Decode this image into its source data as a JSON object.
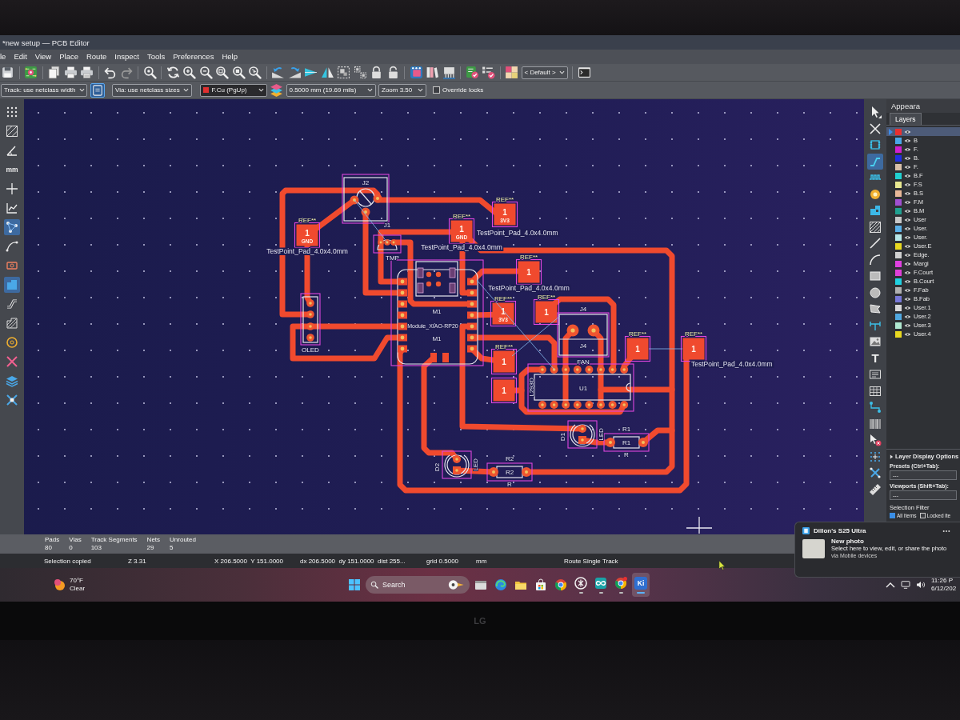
{
  "window": {
    "title": "*new setup — PCB Editor"
  },
  "menu": [
    "le",
    "Edit",
    "View",
    "Place",
    "Route",
    "Inspect",
    "Tools",
    "Preferences",
    "Help"
  ],
  "toolbar": {
    "preset": "< Default >"
  },
  "options_bar": {
    "track_width": "Track: use netclass width",
    "auto_width": {
      "on": true
    },
    "via_size": "Via: use netclass sizes",
    "layer": "F.Cu (PgUp)",
    "grid": "0.5000 mm (19.69 mils)",
    "zoom": "Zoom 3.50",
    "override_locks": {
      "label": "Override locks",
      "checked": false
    }
  },
  "left_toolbar": [
    {
      "on": false
    },
    {
      "on": false
    },
    {
      "on": false
    },
    {
      "label": "mm",
      "on": false
    },
    {
      "on": false
    },
    {
      "on": false
    },
    {
      "on": true
    },
    {
      "on": false
    },
    {
      "on": false
    },
    {
      "on": true
    },
    {
      "on": false
    },
    {
      "on": false
    },
    {
      "on": false
    },
    {
      "on": false
    },
    {
      "on": false
    },
    {
      "on": false
    }
  ],
  "board": {
    "footprints": [
      {
        "kind": "test_point",
        "ref": "REF**",
        "pad": "1",
        "net": "GND",
        "value": "TestPoint_Pad_4.0x4.0mm"
      },
      {
        "kind": "connector",
        "ref": "J2"
      },
      {
        "kind": "sensor",
        "ref": "J1",
        "value": "TMP"
      },
      {
        "kind": "test_point",
        "ref": "REF**",
        "pad": "1",
        "net": "GND",
        "value": "TestPoint_Pad_4.0x4.0mm"
      },
      {
        "kind": "test_point",
        "ref": "REF**",
        "pad": "1",
        "net": "3V3",
        "value": "TestPoint_Pad_4.0x4.0mm"
      },
      {
        "kind": "header",
        "value": "OLED"
      },
      {
        "kind": "module",
        "ref": "M1",
        "value": "Module_XIAO-RP20",
        "fab_ref": "M1"
      },
      {
        "kind": "test_point",
        "ref": "REF**",
        "pad": "1",
        "value": "TestPoint_Pad_4.0x4.0mm"
      },
      {
        "kind": "test_point",
        "ref": "REF**",
        "pad": "1",
        "net": "3V3"
      },
      {
        "kind": "test_point",
        "ref": "REF**",
        "pad": "1"
      },
      {
        "kind": "test_point",
        "ref": "REF**",
        "pad": "1"
      },
      {
        "kind": "fan_connector",
        "ref": "J4",
        "fab_ref": "J4",
        "value": "FAN"
      },
      {
        "kind": "test_point",
        "ref": "REF**",
        "pad": "1"
      },
      {
        "kind": "test_point",
        "ref": "REF**",
        "pad": "1",
        "value": "TestPoint_Pad_4.0x4.0mm"
      },
      {
        "kind": "test_point",
        "pad": "1"
      },
      {
        "kind": "ic",
        "ref": "U1",
        "value": "L293D"
      },
      {
        "kind": "led",
        "ref": "D2",
        "value": "LED"
      },
      {
        "kind": "resistor",
        "ref": "R2",
        "fab_ref": "R2",
        "value": "R"
      },
      {
        "kind": "led",
        "ref": "D1",
        "value": "LED"
      },
      {
        "kind": "resistor",
        "ref": "R1",
        "fab_ref": "R1",
        "value": "R"
      }
    ]
  },
  "draw_toolbar": [
    {
      "selected": false
    },
    {
      "selected": false
    },
    {
      "selected": false
    },
    {
      "selected": true
    },
    {
      "selected": false
    },
    {
      "selected": false
    },
    {
      "selected": false
    },
    {
      "selected": false
    },
    {
      "selected": false
    },
    {
      "selected": false
    },
    {
      "selected": false
    },
    {
      "selected": false
    },
    {
      "selected": false
    },
    {
      "selected": false
    },
    {
      "selected": false
    },
    {
      "label": "T",
      "selected": false
    },
    {
      "selected": false
    },
    {
      "selected": false
    },
    {
      "selected": false
    },
    {
      "selected": false
    },
    {
      "selected": false
    },
    {
      "selected": false
    },
    {
      "selected": false
    },
    {
      "selected": false
    }
  ],
  "appearance": {
    "title": "Appeara",
    "tabs": [
      {
        "label": "Layers",
        "selected": true
      }
    ],
    "layers": [
      {
        "color": "#e83030",
        "visible": true,
        "selected": true
      },
      {
        "name": "B",
        "color": "#4aa8e8",
        "visible": true,
        "selected": false
      },
      {
        "name": "F.",
        "color": "#d020d0",
        "visible": true,
        "selected": false
      },
      {
        "name": "B.",
        "color": "#2030e0",
        "visible": true,
        "selected": false
      },
      {
        "name": "F.",
        "color": "#d8c0a8",
        "visible": true,
        "selected": false
      },
      {
        "name": "B.F",
        "color": "#20d0d0",
        "visible": true,
        "selected": false
      },
      {
        "name": "F.S",
        "color": "#e8e890",
        "visible": true,
        "selected": false
      },
      {
        "name": "B.S",
        "color": "#e8b898",
        "visible": true,
        "selected": false
      },
      {
        "name": "F.M",
        "color": "#a050d0",
        "visible": true,
        "selected": false
      },
      {
        "name": "B.M",
        "color": "#20a090",
        "visible": true,
        "selected": false
      },
      {
        "name": "User",
        "color": "#c8c8c8",
        "visible": true,
        "selected": false
      },
      {
        "name": "User.",
        "color": "#5ab0e8",
        "visible": true,
        "selected": false
      },
      {
        "name": "User.",
        "color": "#b8e8e8",
        "visible": true,
        "selected": false
      },
      {
        "name": "User.E",
        "color": "#e8d820",
        "visible": true,
        "selected": false
      },
      {
        "name": "Edge.",
        "color": "#d0d0d0",
        "visible": true,
        "selected": false
      },
      {
        "name": "Margi",
        "color": "#e040e0",
        "visible": true,
        "selected": false
      },
      {
        "name": "F.Court",
        "color": "#e040d8",
        "visible": true,
        "selected": false
      },
      {
        "name": "B.Court",
        "color": "#20d0e0",
        "visible": true,
        "selected": false
      },
      {
        "name": "F.Fab",
        "color": "#b0b0b0",
        "visible": true,
        "selected": false
      },
      {
        "name": "B.Fab",
        "color": "#7878d8",
        "visible": true,
        "selected": false
      },
      {
        "name": "User.1",
        "color": "#d8d8d8",
        "visible": true,
        "selected": false
      },
      {
        "name": "User.2",
        "color": "#50a8e0",
        "visible": true,
        "selected": false
      },
      {
        "name": "User.3",
        "color": "#b0e8d0",
        "visible": true,
        "selected": false
      },
      {
        "name": "User.4",
        "color": "#e8d820",
        "visible": true,
        "selected": false
      }
    ],
    "display_options": {
      "label": "Layer Display Options",
      "expanded": false
    },
    "presets": {
      "label": "Presets (Ctrl+Tab):",
      "value": "---"
    },
    "viewports": {
      "label": "Viewports (Shift+Tab):",
      "value": "---"
    },
    "selection_filter": {
      "title": "Selection Filter",
      "options": [
        {
          "label": "All items",
          "checked": true
        },
        {
          "label": "Locked ite",
          "checked": false
        }
      ]
    }
  },
  "status_bar": {
    "counts": [
      {
        "label": "Pads",
        "value": "80"
      },
      {
        "label": "Vias",
        "value": "0"
      },
      {
        "label": "Track Segments",
        "value": "103"
      },
      {
        "label": "Nets",
        "value": "29"
      },
      {
        "label": "Unrouted",
        "value": "5"
      }
    ],
    "message": "Selection copied",
    "zoom": "Z 3.31",
    "position": "X 206.5000  Y 151.0000",
    "delta": "dx 206.5000  dy 151.0000  dist 255...",
    "grid": "grid 0.5000",
    "units": "mm",
    "tool": "Route Single Track"
  },
  "taskbar": {
    "weather": {
      "temperature": "70°F",
      "condition": "Clear"
    },
    "search": {
      "placeholder": "Search"
    },
    "apps": [
      {
        "running": false,
        "selected": false
      },
      {
        "running": false,
        "selected": false
      },
      {
        "running": false,
        "selected": false
      },
      {
        "running": false,
        "selected": false
      },
      {
        "running": false,
        "selected": false
      },
      {
        "running": true,
        "selected": false
      },
      {
        "running": true,
        "selected": false
      },
      {
        "running": true,
        "selected": false
      },
      {
        "label": "Ki",
        "running": true,
        "selected": true
      }
    ],
    "time": "11:26 P",
    "date": "6/12/202"
  },
  "notification": {
    "device": "Dillon's S25 Ultra",
    "title": "New photo",
    "body": "Select here to view, edit, or share the photo",
    "source": "via Mobile devices"
  },
  "monitor": {
    "logo": "LG"
  }
}
